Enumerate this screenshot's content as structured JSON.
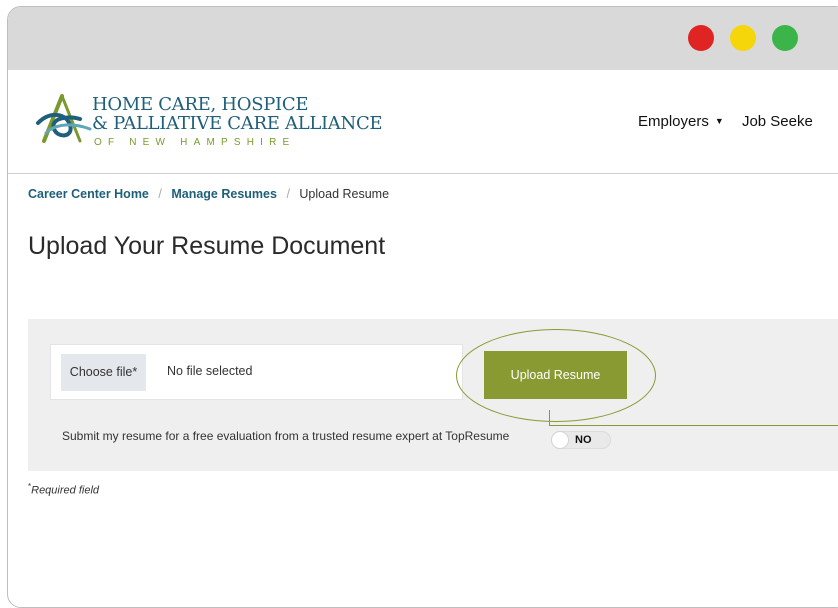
{
  "window": {
    "controls": [
      "close",
      "minimize",
      "maximize"
    ]
  },
  "logo": {
    "line1": "HOME CARE, HOSPICE",
    "line2": "& PALLIATIVE CARE ALLIANCE",
    "line3": "OF NEW HAMPSHIRE",
    "colors": {
      "primary": "#1f5f7a",
      "accent": "#7a9a2e"
    }
  },
  "nav": {
    "items": [
      {
        "label": "Employers",
        "icon": "caret-down-icon"
      },
      {
        "label": "Job Seeke"
      }
    ]
  },
  "breadcrumb": {
    "items": [
      "Career Center Home",
      "Manage Resumes",
      "Upload Resume"
    ],
    "separator": "/"
  },
  "page": {
    "title": "Upload Your Resume Document"
  },
  "form": {
    "choose_file_label": "Choose file*",
    "file_status": "No file selected",
    "upload_button": "Upload Resume",
    "upload_button_color": "#8a9a33",
    "evaluation_text": "Submit my resume for a free evaluation from a trusted resume expert at TopResume",
    "evaluation_toggle": "NO",
    "required_marker": "*",
    "required_note": "Required field"
  }
}
